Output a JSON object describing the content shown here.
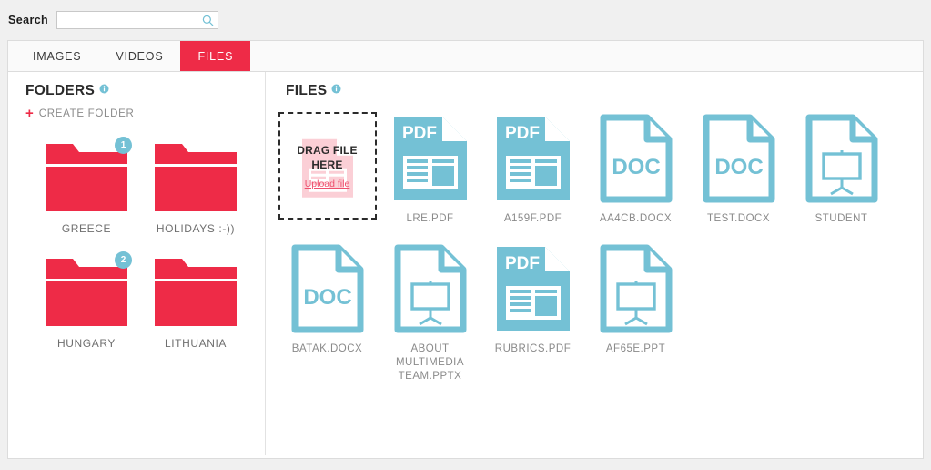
{
  "colors": {
    "accent_red": "#ee2b47",
    "accent_teal": "#74c1d5",
    "panel_bg": "#ffffff",
    "page_bg": "#f0f0f0",
    "label_gray": "#8a8a8a"
  },
  "search": {
    "label": "Search",
    "value": "",
    "placeholder": "",
    "icon": "search-icon"
  },
  "tabs": [
    {
      "label": "IMAGES",
      "active": false
    },
    {
      "label": "VIDEOS",
      "active": false
    },
    {
      "label": "FILES",
      "active": true
    }
  ],
  "folders_panel": {
    "title": "FOLDERS",
    "info_icon": "info-icon",
    "create_label": "CREATE FOLDER",
    "create_plus": "+",
    "items": [
      {
        "name": "GREECE",
        "badge": "1"
      },
      {
        "name": "HOLIDAYS :-))",
        "badge": ""
      },
      {
        "name": "HUNGARY",
        "badge": "2"
      },
      {
        "name": "LITHUANIA",
        "badge": ""
      }
    ]
  },
  "files_panel": {
    "title": "FILES",
    "info_icon": "info-icon",
    "dropzone": {
      "line1": "DRAG FILE",
      "line2": "HERE",
      "upload_link": "Upload file"
    },
    "items": [
      {
        "name": "LRE.PDF",
        "kind": "pdf"
      },
      {
        "name": "A159F.PDF",
        "kind": "pdf"
      },
      {
        "name": "AA4CB.DOCX",
        "kind": "doc"
      },
      {
        "name": "TEST.DOCX",
        "kind": "doc"
      },
      {
        "name": "STUDENT",
        "kind": "ppt"
      },
      {
        "name": "BATAK.DOCX",
        "kind": "doc"
      },
      {
        "name": "ABOUT MULTIMEDIA TEAM.PPTX",
        "kind": "ppt"
      },
      {
        "name": "RUBRICS.PDF",
        "kind": "pdf"
      },
      {
        "name": "AF65E.PPT",
        "kind": "ppt"
      }
    ]
  }
}
